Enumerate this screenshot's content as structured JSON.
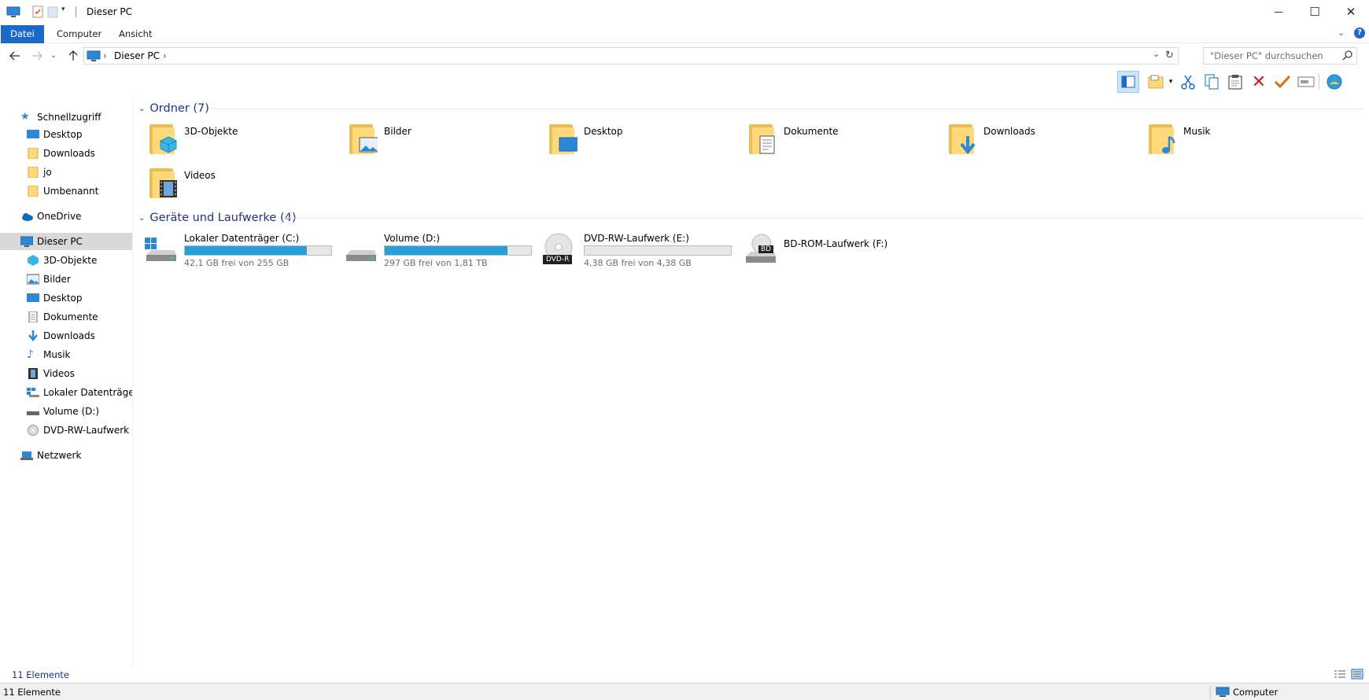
{
  "window": {
    "title": "Dieser PC",
    "minimize": "—",
    "maximize": "☐",
    "close": "✕"
  },
  "ribbon": {
    "tabs": [
      {
        "label": "Datei"
      },
      {
        "label": "Computer"
      },
      {
        "label": "Ansicht"
      }
    ]
  },
  "address": {
    "segments": [
      "Dieser PC"
    ],
    "separator": "›",
    "search_placeholder": "\"Dieser PC\" durchsuchen"
  },
  "toolbar": {
    "icons": [
      "preview-pane-icon",
      "new-folder-icon",
      "cut-icon",
      "copy-icon",
      "paste-icon",
      "delete-icon",
      "checkmark-icon",
      "rename-icon",
      "globe-icon"
    ]
  },
  "nav": {
    "quick_access": "Schnellzugriff",
    "quick_items": [
      "Desktop",
      "Downloads",
      "jo",
      "Umbenannt"
    ],
    "onedrive": "OneDrive",
    "this_pc": "Dieser PC",
    "pc_items": [
      "3D-Objekte",
      "Bilder",
      "Desktop",
      "Dokumente",
      "Downloads",
      "Musik",
      "Videos",
      "Lokaler Datenträger (C",
      "Volume (D:)",
      "DVD-RW-Laufwerk (E"
    ],
    "network": "Netzwerk"
  },
  "content": {
    "folders_header": "Ordner (7)",
    "folders": [
      {
        "name": "3D-Objekte",
        "icon": "3d-objects-icon"
      },
      {
        "name": "Bilder",
        "icon": "pictures-icon"
      },
      {
        "name": "Desktop",
        "icon": "desktop-icon"
      },
      {
        "name": "Dokumente",
        "icon": "documents-icon"
      },
      {
        "name": "Downloads",
        "icon": "downloads-icon"
      },
      {
        "name": "Musik",
        "icon": "music-icon"
      },
      {
        "name": "Videos",
        "icon": "videos-icon"
      }
    ],
    "drives_header": "Geräte und Laufwerke (4)",
    "drives": [
      {
        "name": "Lokaler Datenträger (C:)",
        "free": "42,1 GB frei von 255 GB",
        "used_fraction": 0.835
      },
      {
        "name": "Volume (D:)",
        "free": "297 GB frei von 1,81 TB",
        "used_fraction": 0.84
      },
      {
        "name": "DVD-RW-Laufwerk (E:)",
        "free": "4,38 GB frei von 4,38 GB",
        "used_fraction": 0.0,
        "badge": "DVD-R"
      },
      {
        "name": "BD-ROM-Laufwerk (F:)",
        "badge": "BD"
      }
    ]
  },
  "status": {
    "count": "11 Elemente",
    "location": "Computer"
  },
  "colors": {
    "accent": "#1b6ac9",
    "drive_bar": "#26a0da",
    "group_header": "#1e3287"
  }
}
